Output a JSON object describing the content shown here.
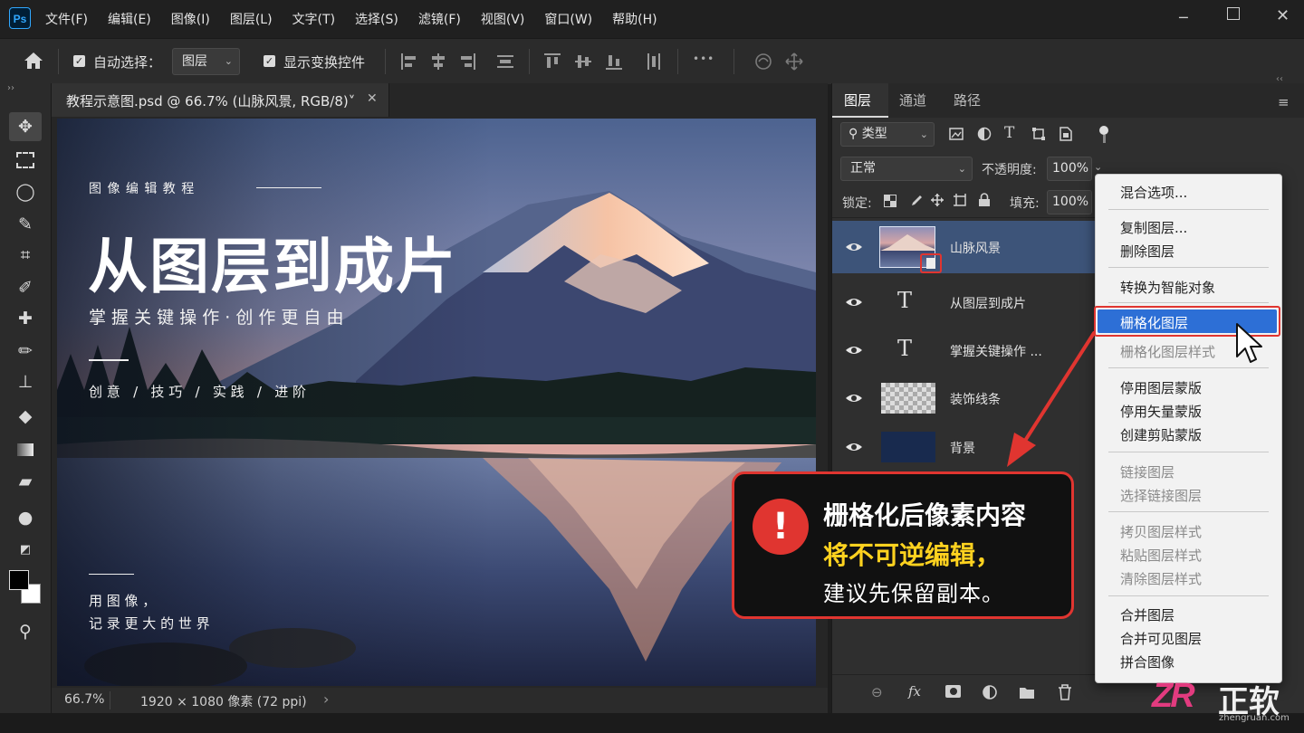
{
  "app": {
    "logo": "Ps",
    "menu": [
      "文件(F)",
      "编辑(E)",
      "图像(I)",
      "图层(L)",
      "文字(T)",
      "选择(S)",
      "滤镜(F)",
      "视图(V)",
      "窗口(W)",
      "帮助(H)"
    ]
  },
  "options": {
    "auto_select_label": "自动选择：",
    "auto_select_value": "图层",
    "show_transform_label": "显示变换控件",
    "more": "•••"
  },
  "document": {
    "tab_title": "教程示意图.psd  @ 66.7% (山脉风景, RGB/8)˅",
    "close": "✕",
    "zoom": "66.7%",
    "dims": "1920 × 1080 像素 (72 ppi)",
    "arrow": "›"
  },
  "poster": {
    "eyebrow": "图 像 编 辑 教 程",
    "headline": "从图层到成片",
    "subhead": "掌 握 关 键 操 作 · 创 作 更 自 由",
    "tags": "创 意   /   技 巧   /   实 践   /   进 阶",
    "footer_line1": "用 图 像 ，",
    "footer_line2": "记 录 更 大 的 世 界"
  },
  "panel": {
    "tabs": [
      "图层",
      "通道",
      "路径"
    ],
    "filter_label": "类型",
    "blend_mode": "正常",
    "opacity_label": "不透明度:",
    "opacity_value": "100%",
    "lock_label": "锁定:",
    "fill_label": "填充:",
    "fill_value": "100%",
    "text_glyph": "T"
  },
  "layers": [
    {
      "name": "山脉风景"
    },
    {
      "name": "从图层到成片"
    },
    {
      "name": "掌握关键操作 ..."
    },
    {
      "name": "装饰线条"
    },
    {
      "name": "背景"
    }
  ],
  "context_menu": {
    "items": [
      {
        "label": "混合选项...",
        "disabled": false
      },
      {
        "label": "复制图层...",
        "disabled": false
      },
      {
        "label": "删除图层",
        "disabled": false
      },
      {
        "label": "转换为智能对象",
        "disabled": false
      },
      {
        "label": "栅格化图层",
        "disabled": false,
        "highlighted": true
      },
      {
        "label": "栅格化图层样式",
        "disabled": true
      },
      {
        "label": "停用图层蒙版",
        "disabled": false
      },
      {
        "label": "停用矢量蒙版",
        "disabled": false
      },
      {
        "label": "创建剪贴蒙版",
        "disabled": false
      },
      {
        "label": "链接图层",
        "disabled": true
      },
      {
        "label": "选择链接图层",
        "disabled": true
      },
      {
        "label": "拷贝图层样式",
        "disabled": true
      },
      {
        "label": "粘贴图层样式",
        "disabled": true
      },
      {
        "label": "清除图层样式",
        "disabled": true
      },
      {
        "label": "合并图层",
        "disabled": false
      },
      {
        "label": "合并可见图层",
        "disabled": false
      },
      {
        "label": "拼合图像",
        "disabled": false
      }
    ]
  },
  "callout": {
    "line1": "栅格化后像素内容",
    "line2": "将不可逆编辑，",
    "line3": "建议先保留副本。",
    "icon": "!"
  },
  "watermark": {
    "logo": "ZR",
    "brand": "正软",
    "url": "zhengruan.com"
  },
  "colors": {
    "accent_blue": "#2d6fd6",
    "alert_red": "#e03530",
    "highlight_yellow": "#ffd21f"
  }
}
